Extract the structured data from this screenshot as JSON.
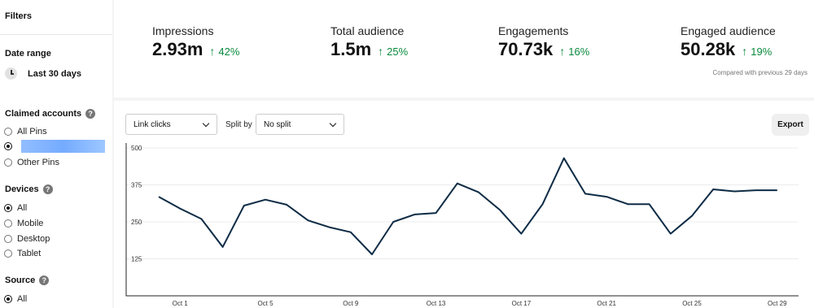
{
  "sidebar": {
    "title": "Filters",
    "date_range": {
      "heading": "Date range",
      "value": "Last 30 days"
    },
    "claimed_accounts": {
      "heading": "Claimed accounts",
      "options": [
        {
          "label": "All Pins",
          "checked": false
        },
        {
          "label": "",
          "checked": true
        },
        {
          "label": "Other Pins",
          "checked": false
        }
      ]
    },
    "devices": {
      "heading": "Devices",
      "options": [
        {
          "label": "All",
          "checked": true
        },
        {
          "label": "Mobile",
          "checked": false
        },
        {
          "label": "Desktop",
          "checked": false
        },
        {
          "label": "Tablet",
          "checked": false
        }
      ]
    },
    "source": {
      "heading": "Source",
      "options": [
        {
          "label": "All",
          "checked": true
        }
      ]
    }
  },
  "metrics": [
    {
      "label": "Impressions",
      "value": "2.93m",
      "change": "42%"
    },
    {
      "label": "Total audience",
      "value": "1.5m",
      "change": "25%"
    },
    {
      "label": "Engagements",
      "value": "70.73k",
      "change": "16%"
    },
    {
      "label": "Engaged audience",
      "value": "50.28k",
      "change": "19%"
    }
  ],
  "compared_text": "Compared with previous 29 days",
  "controls": {
    "metric_select": "Link clicks",
    "split_label": "Split by",
    "split_select": "No split",
    "export_label": "Export"
  },
  "colors": {
    "line": "#0d2b45",
    "positive": "#0a8a3d",
    "accent": "#767676"
  },
  "chart_data": {
    "type": "line",
    "x_tick_labels": [
      "Oct 1",
      "Oct 5",
      "Oct 9",
      "Oct 13",
      "Oct 17",
      "Oct 21",
      "Oct 25",
      "Oct 29"
    ],
    "y_tick_labels": [
      "125",
      "250",
      "375",
      "500"
    ],
    "ylim": [
      0,
      500
    ],
    "grid": true,
    "x": [
      "Sep 30",
      "Oct 1",
      "Oct 2",
      "Oct 3",
      "Oct 4",
      "Oct 5",
      "Oct 6",
      "Oct 7",
      "Oct 8",
      "Oct 9",
      "Oct 10",
      "Oct 11",
      "Oct 12",
      "Oct 13",
      "Oct 14",
      "Oct 15",
      "Oct 16",
      "Oct 17",
      "Oct 18",
      "Oct 19",
      "Oct 20",
      "Oct 21",
      "Oct 22",
      "Oct 23",
      "Oct 24",
      "Oct 25",
      "Oct 26",
      "Oct 27",
      "Oct 28",
      "Oct 29"
    ],
    "series": [
      {
        "values": [
          335,
          295,
          260,
          165,
          305,
          325,
          308,
          255,
          232,
          215,
          140,
          250,
          275,
          280,
          380,
          350,
          290,
          210,
          310,
          465,
          345,
          335,
          310,
          310,
          210,
          270,
          360,
          353,
          357,
          357
        ]
      }
    ]
  }
}
